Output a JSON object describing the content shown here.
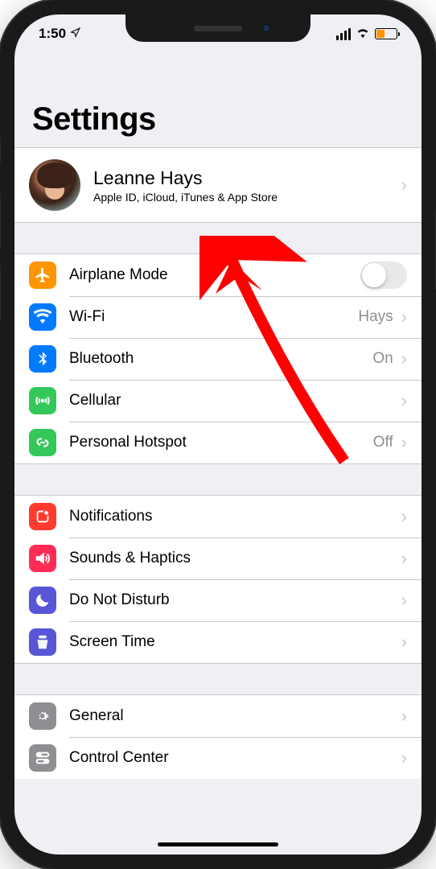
{
  "status": {
    "time": "1:50",
    "location_icon": "location-arrow",
    "battery_color": "#ff9500"
  },
  "page": {
    "title": "Settings"
  },
  "profile": {
    "name": "Leanne Hays",
    "subtitle": "Apple ID, iCloud, iTunes & App Store"
  },
  "groups": [
    {
      "items": [
        {
          "icon": "airplane",
          "icon_class": "icon-orange",
          "label": "Airplane Mode",
          "control": "toggle",
          "toggle_on": false
        },
        {
          "icon": "wifi",
          "icon_class": "icon-blue",
          "label": "Wi-Fi",
          "value": "Hays",
          "chevron": true
        },
        {
          "icon": "bluetooth",
          "icon_class": "icon-blue",
          "label": "Bluetooth",
          "value": "On",
          "chevron": true
        },
        {
          "icon": "cellular",
          "icon_class": "icon-green",
          "label": "Cellular",
          "chevron": true
        },
        {
          "icon": "hotspot",
          "icon_class": "icon-green",
          "label": "Personal Hotspot",
          "value": "Off",
          "chevron": true
        }
      ]
    },
    {
      "items": [
        {
          "icon": "notifications",
          "icon_class": "icon-red",
          "label": "Notifications",
          "chevron": true
        },
        {
          "icon": "sounds",
          "icon_class": "icon-pink",
          "label": "Sounds & Haptics",
          "chevron": true
        },
        {
          "icon": "dnd",
          "icon_class": "icon-purple",
          "label": "Do Not Disturb",
          "chevron": true
        },
        {
          "icon": "screentime",
          "icon_class": "icon-purple",
          "label": "Screen Time",
          "chevron": true
        }
      ]
    },
    {
      "items": [
        {
          "icon": "general",
          "icon_class": "icon-gray",
          "label": "General",
          "chevron": true
        },
        {
          "icon": "controlcenter",
          "icon_class": "icon-gray",
          "label": "Control Center",
          "chevron": true
        }
      ]
    }
  ]
}
